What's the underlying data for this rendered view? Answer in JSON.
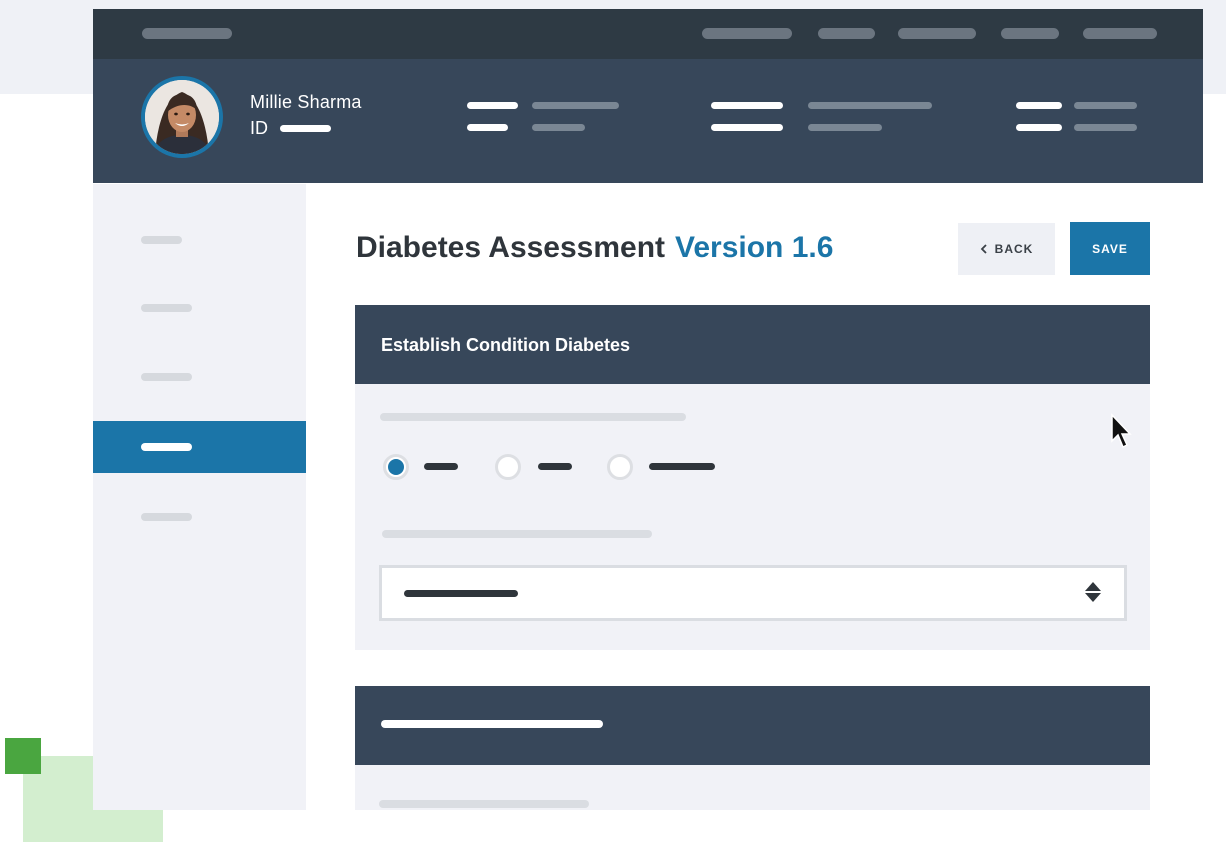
{
  "patient": {
    "name": "Millie Sharma",
    "id_label": "ID"
  },
  "page": {
    "title": "Diabetes Assessment",
    "version": "Version 1.6"
  },
  "actions": {
    "back_label": "BACK",
    "save_label": "SAVE",
    "back_icon": "chevron-left-icon"
  },
  "section": {
    "title": "Establish Condition Diabetes",
    "radio_selected_index": 0,
    "radio_count": 3,
    "select_icon": "updown-arrows-icon"
  },
  "sidebar": {
    "active_index": 3,
    "item_count": 5
  },
  "colors": {
    "primary": "#1b75a8",
    "header_dark": "#2e3a44",
    "header": "#37475a",
    "panel_bg": "#f1f2f7",
    "accent_green": "#4aa640",
    "accent_green_light": "#d3eecf"
  }
}
